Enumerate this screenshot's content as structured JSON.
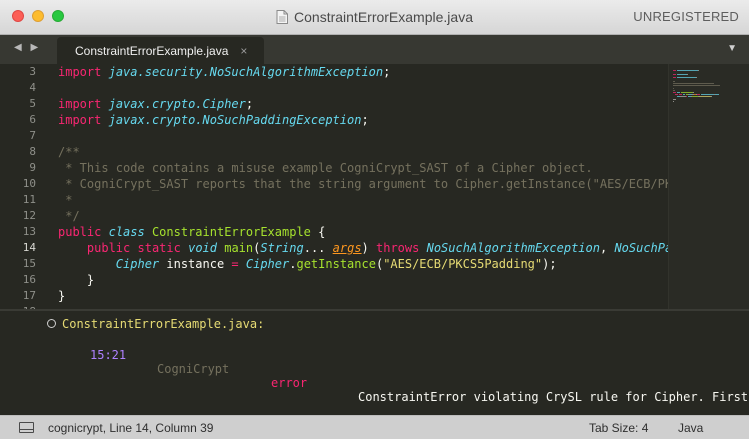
{
  "window": {
    "title": "ConstraintErrorExample.java",
    "unregistered": "UNREGISTERED"
  },
  "tabbar": {
    "nav": "◀ ▶",
    "tab_label": "ConstraintErrorExample.java",
    "tab_close": "×",
    "dropdown": "▼"
  },
  "editor": {
    "active_line": 14,
    "lines": [
      {
        "n": "3",
        "tokens": [
          [
            "kw",
            "import"
          ],
          [
            "plain",
            " "
          ],
          [
            "ty",
            "java.security.NoSuchAlgorithmException"
          ],
          [
            "plain",
            ";"
          ]
        ]
      },
      {
        "n": "4",
        "tokens": []
      },
      {
        "n": "5",
        "tokens": [
          [
            "kw",
            "import"
          ],
          [
            "plain",
            " "
          ],
          [
            "ty",
            "javax.crypto.Cipher"
          ],
          [
            "plain",
            ";"
          ]
        ]
      },
      {
        "n": "6",
        "tokens": [
          [
            "kw",
            "import"
          ],
          [
            "plain",
            " "
          ],
          [
            "ty",
            "javax.crypto.NoSuchPaddingException"
          ],
          [
            "plain",
            ";"
          ]
        ]
      },
      {
        "n": "7",
        "tokens": []
      },
      {
        "n": "8",
        "tokens": [
          [
            "cm",
            "/**"
          ]
        ]
      },
      {
        "n": "9",
        "tokens": [
          [
            "cm",
            " * This code contains a misuse example CogniCrypt_SAST of a Cipher object."
          ]
        ]
      },
      {
        "n": "10",
        "tokens": [
          [
            "cm",
            " * CogniCrypt_SAST reports that the string argument to Cipher.getInstance(\"AES/ECB/PK"
          ]
        ]
      },
      {
        "n": "11",
        "tokens": [
          [
            "cm",
            " *"
          ]
        ]
      },
      {
        "n": "12",
        "tokens": [
          [
            "cm",
            " */"
          ]
        ]
      },
      {
        "n": "13",
        "tokens": [
          [
            "kw",
            "public"
          ],
          [
            "plain",
            " "
          ],
          [
            "ty",
            "class"
          ],
          [
            "plain",
            " "
          ],
          [
            "cls",
            "ConstraintErrorExample"
          ],
          [
            "plain",
            " {"
          ]
        ]
      },
      {
        "n": "14",
        "tokens": [
          [
            "plain",
            "    "
          ],
          [
            "kw",
            "public"
          ],
          [
            "plain",
            " "
          ],
          [
            "kw",
            "static"
          ],
          [
            "plain",
            " "
          ],
          [
            "ty",
            "void"
          ],
          [
            "plain",
            " "
          ],
          [
            "cls",
            "main"
          ],
          [
            "plain",
            "("
          ],
          [
            "ty",
            "String"
          ],
          [
            "plain",
            "... "
          ],
          [
            "param",
            "args"
          ],
          [
            "plain",
            ") "
          ],
          [
            "kw",
            "throws"
          ],
          [
            "plain",
            " "
          ],
          [
            "ty",
            "NoSuchAlgorithmException"
          ],
          [
            "plain",
            ", "
          ],
          [
            "ty",
            "NoSuchPa"
          ]
        ]
      },
      {
        "n": "15",
        "tokens": [
          [
            "plain",
            "        "
          ],
          [
            "ty",
            "Cipher"
          ],
          [
            "plain",
            " instance "
          ],
          [
            "kw",
            "="
          ],
          [
            "plain",
            " "
          ],
          [
            "ty",
            "Cipher"
          ],
          [
            "plain",
            "."
          ],
          [
            "cls",
            "getInstance"
          ],
          [
            "plain",
            "("
          ],
          [
            "str",
            "\"AES/ECB/PKCS5Padding\""
          ],
          [
            "plain",
            ");"
          ]
        ]
      },
      {
        "n": "16",
        "tokens": [
          [
            "plain",
            "    }"
          ]
        ]
      },
      {
        "n": "17",
        "tokens": [
          [
            "plain",
            "}"
          ]
        ]
      },
      {
        "n": "18",
        "tokens": []
      }
    ]
  },
  "output": {
    "file": "ConstraintErrorExample.java:",
    "position": "15:21",
    "source": "CogniCrypt",
    "level": "error",
    "message": "ConstraintError violating CrySL rule for Cipher. First"
  },
  "statusbar": {
    "position_text": "cognicrypt, Line 14, Column 39",
    "tab_size": "Tab Size: 4",
    "language": "Java"
  },
  "colors": {
    "keyword": "#f92672",
    "type": "#66d9ef",
    "class": "#a6e22e",
    "string": "#e6db74",
    "comment": "#75715e",
    "number": "#ae81ff"
  }
}
